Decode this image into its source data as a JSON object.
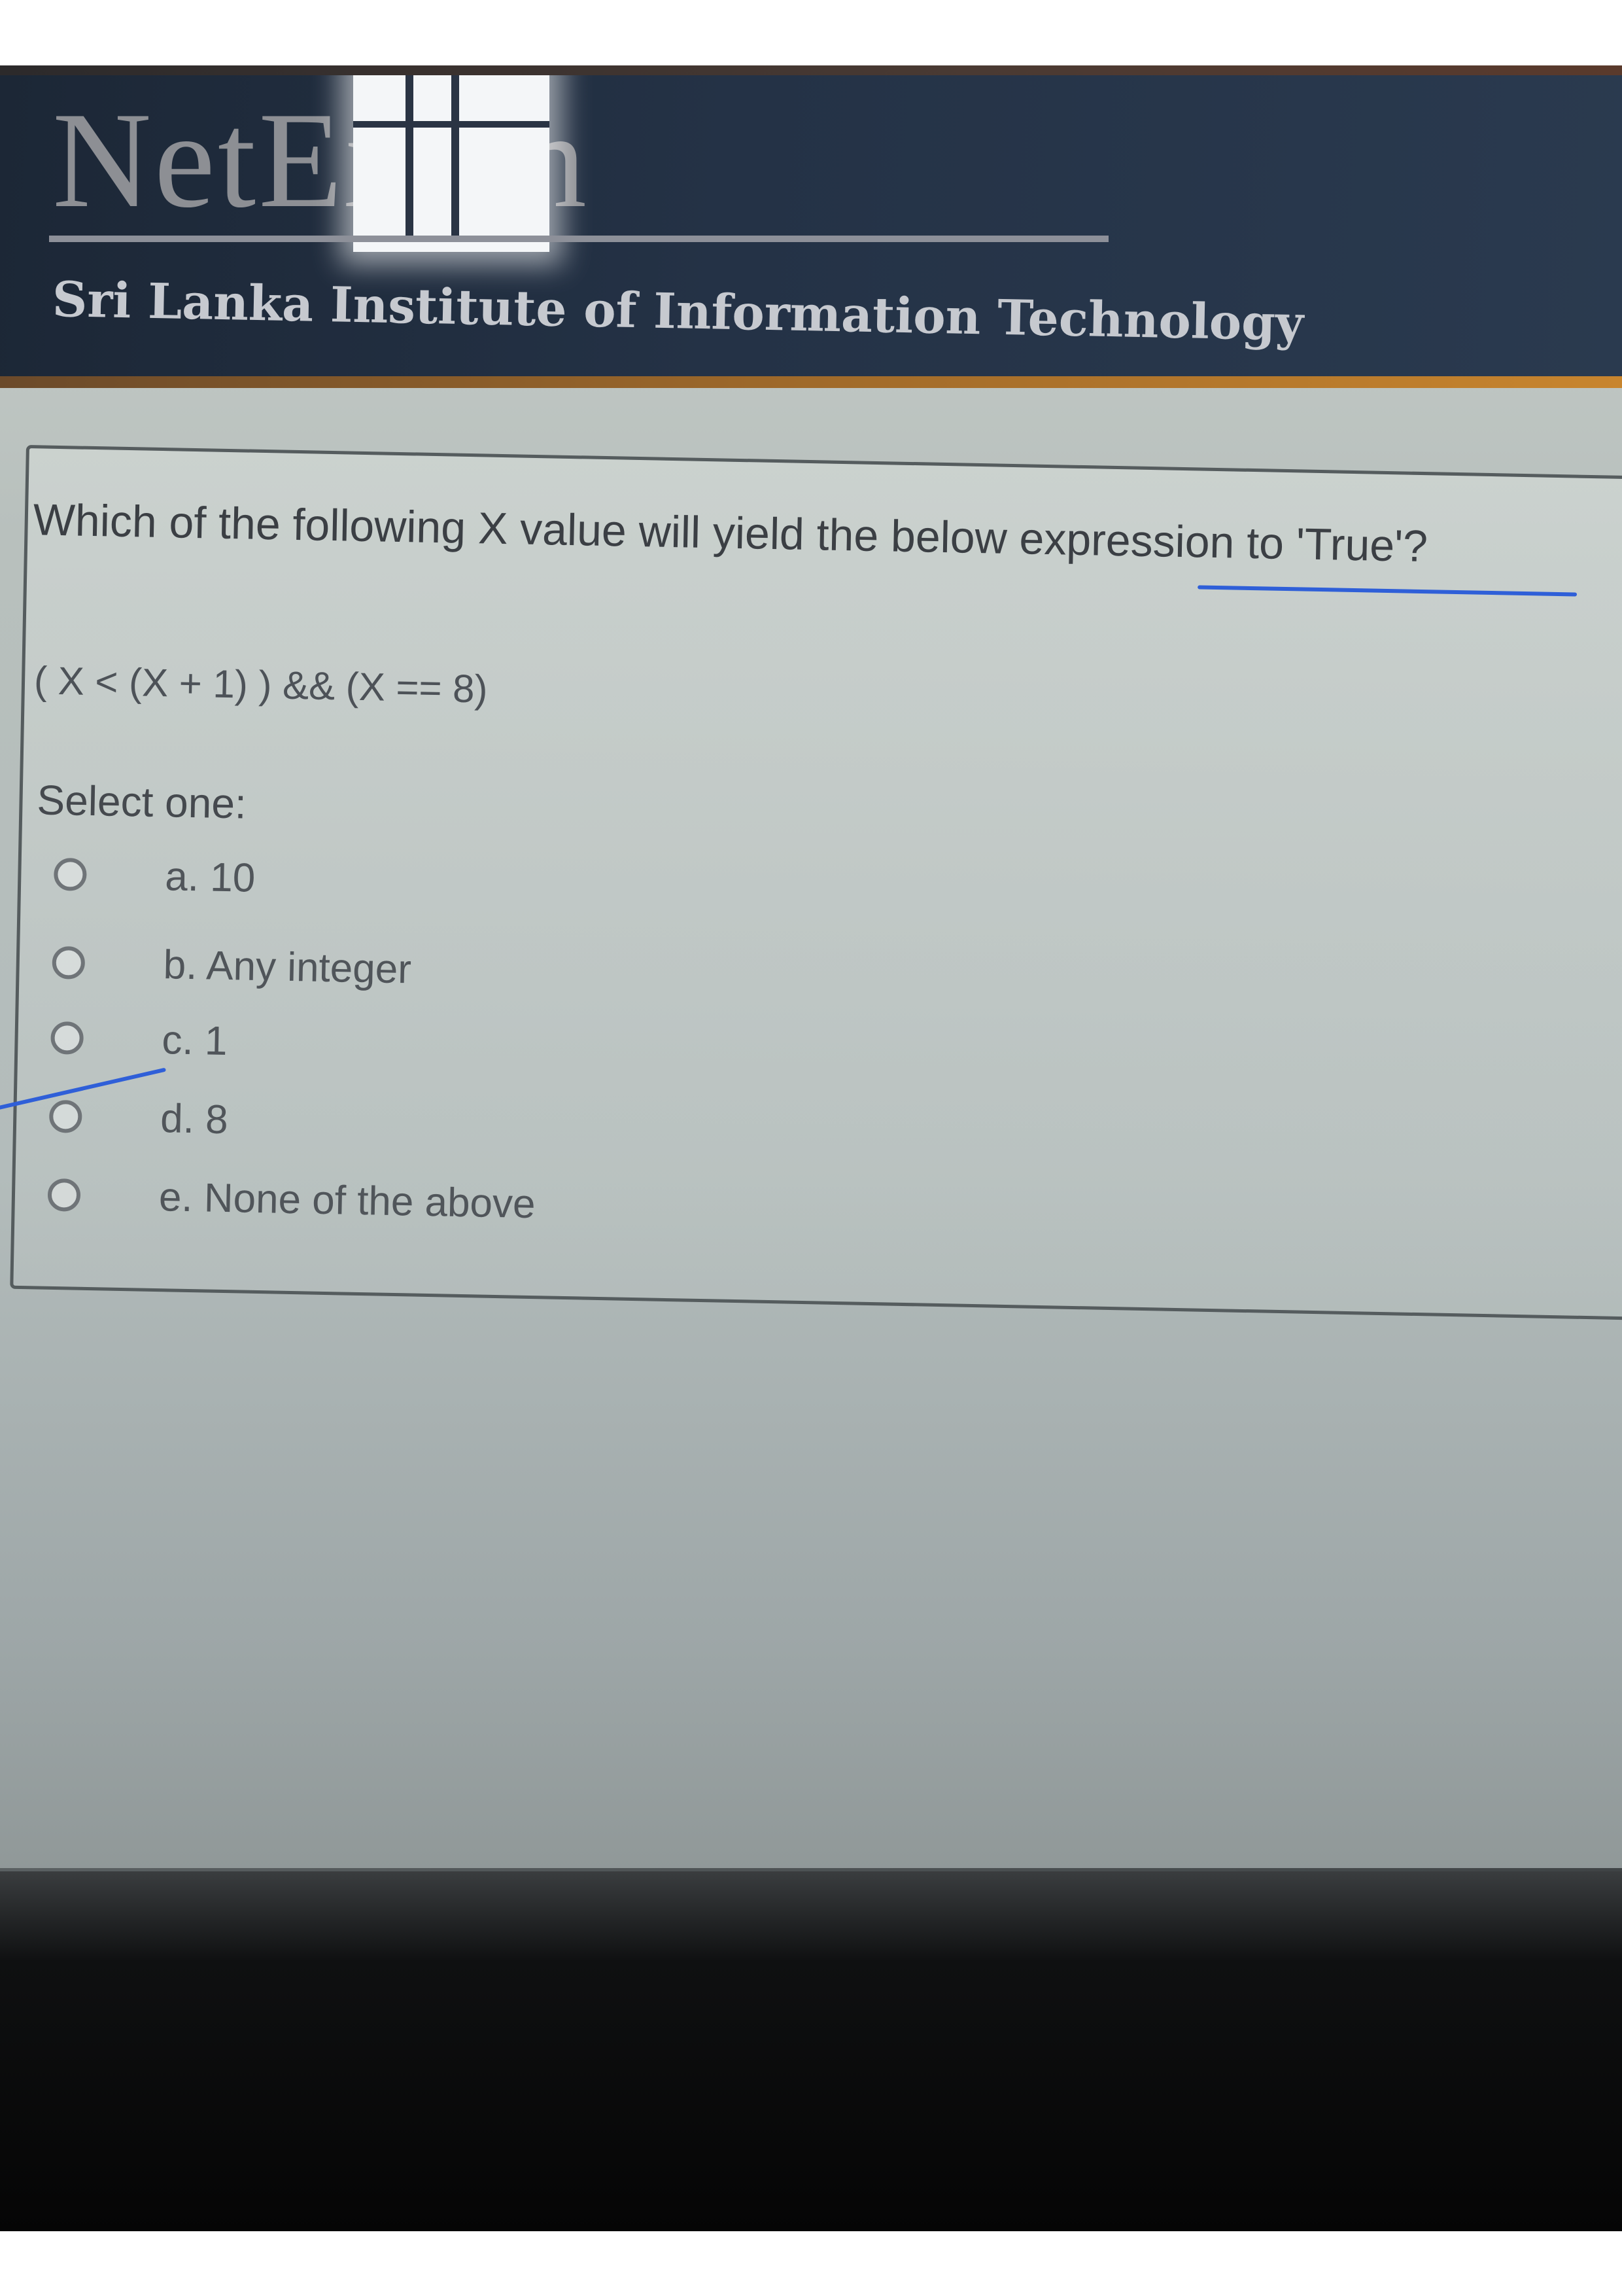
{
  "header": {
    "logo": "NetExam",
    "institute": "Sri Lanka Institute of Information Technology"
  },
  "question": {
    "text": "Which of the following X value will yield the below expression to 'True'?",
    "expression": "( X < (X + 1) ) && (X == 8)",
    "select_label": "Select one:",
    "options": [
      {
        "label": "a. 10",
        "selected": false
      },
      {
        "label": "b. Any integer",
        "selected": false
      },
      {
        "label": "c. 1",
        "selected": false
      },
      {
        "label": "d. 8",
        "selected": false
      },
      {
        "label": "e. None of the above",
        "selected": false
      }
    ]
  },
  "colors": {
    "header_bg": "#243246",
    "header_accent": "#c8852e",
    "ink_annotation": "#2f5fd8",
    "screen_bg": "#b8c0bd"
  }
}
